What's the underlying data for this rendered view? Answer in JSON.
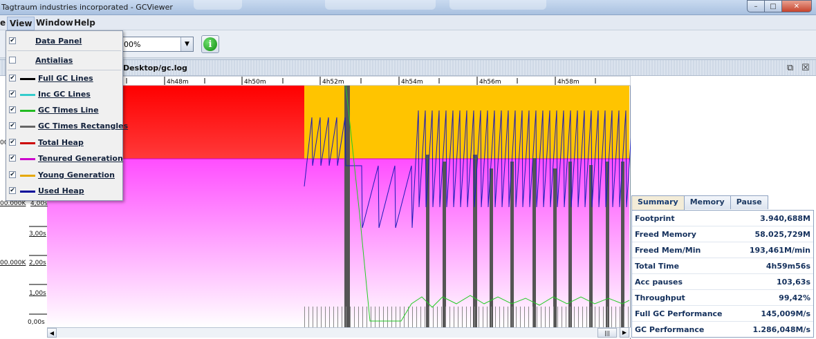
{
  "window": {
    "title": "Tagtraum industries incorporated - GCViewer",
    "buttons": {
      "minimize": "–",
      "maximize": "□",
      "close": "✕"
    }
  },
  "menubar": {
    "items": [
      {
        "label": "e"
      },
      {
        "label": "View"
      },
      {
        "label": "Window"
      },
      {
        "label": "Help"
      }
    ]
  },
  "toolbar": {
    "zoom_value": "00%",
    "info_label": "i"
  },
  "frame": {
    "title": "Desktop/gc.log",
    "restore_icon": "⧉",
    "close_icon": "☒"
  },
  "view_menu": {
    "items": [
      {
        "label": "Data Panel",
        "checked": true,
        "color": ""
      },
      {
        "label": "Antialias",
        "checked": false,
        "color": ""
      },
      {
        "label": "Full GC Lines",
        "checked": true,
        "color": "#000000"
      },
      {
        "label": "Inc GC Lines",
        "checked": true,
        "color": "#33cccc"
      },
      {
        "label": "GC Times Line",
        "checked": true,
        "color": "#22bb22"
      },
      {
        "label": "GC Times Rectangles",
        "checked": true,
        "color": "#666666"
      },
      {
        "label": "Total Heap",
        "checked": true,
        "color": "#cc0000"
      },
      {
        "label": "Tenured Generation",
        "checked": true,
        "color": "#cc00cc"
      },
      {
        "label": "Young Generation",
        "checked": true,
        "color": "#e6a800"
      },
      {
        "label": "Used Heap",
        "checked": true,
        "color": "#000099"
      }
    ]
  },
  "chart": {
    "time_ticks": [
      "4h48m",
      "4h50m",
      "4h52m",
      "4h54m",
      "4h56m",
      "4h58m"
    ],
    "left_labels": [
      {
        "text": "00"
      },
      {
        "text": "00.000K"
      },
      {
        "text": "4,00s"
      },
      {
        "text": "3,00s"
      },
      {
        "text": "00.000K"
      },
      {
        "text": "2,00s"
      },
      {
        "text": "1,00s"
      },
      {
        "text": "0,00s"
      }
    ],
    "colors": {
      "total_heap": "#ff0000",
      "tenured": "#ff00ff",
      "young": "#ffc400",
      "used_heap": "#1a1ab8",
      "gc_times": "#22cc22",
      "gc_rect": "#555555"
    }
  },
  "tabs": [
    {
      "label": "Summary",
      "active": true
    },
    {
      "label": "Memory",
      "active": false
    },
    {
      "label": "Pause",
      "active": false
    }
  ],
  "summary": [
    {
      "key": "Footprint",
      "value": "3.940,688M"
    },
    {
      "key": "Freed Memory",
      "value": "58.025,729M"
    },
    {
      "key": "Freed Mem/Min",
      "value": "193,461M/min"
    },
    {
      "key": "Total Time",
      "value": "4h59m56s"
    },
    {
      "key": "Acc pauses",
      "value": "103,63s"
    },
    {
      "key": "Throughput",
      "value": "99,42%"
    },
    {
      "key": "Full GC Performance",
      "value": "145,009M/s"
    },
    {
      "key": "GC Performance",
      "value": "1.286,048M/s"
    }
  ],
  "scroll": {
    "left": "◀",
    "right": "▶",
    "thumb": "|||"
  }
}
